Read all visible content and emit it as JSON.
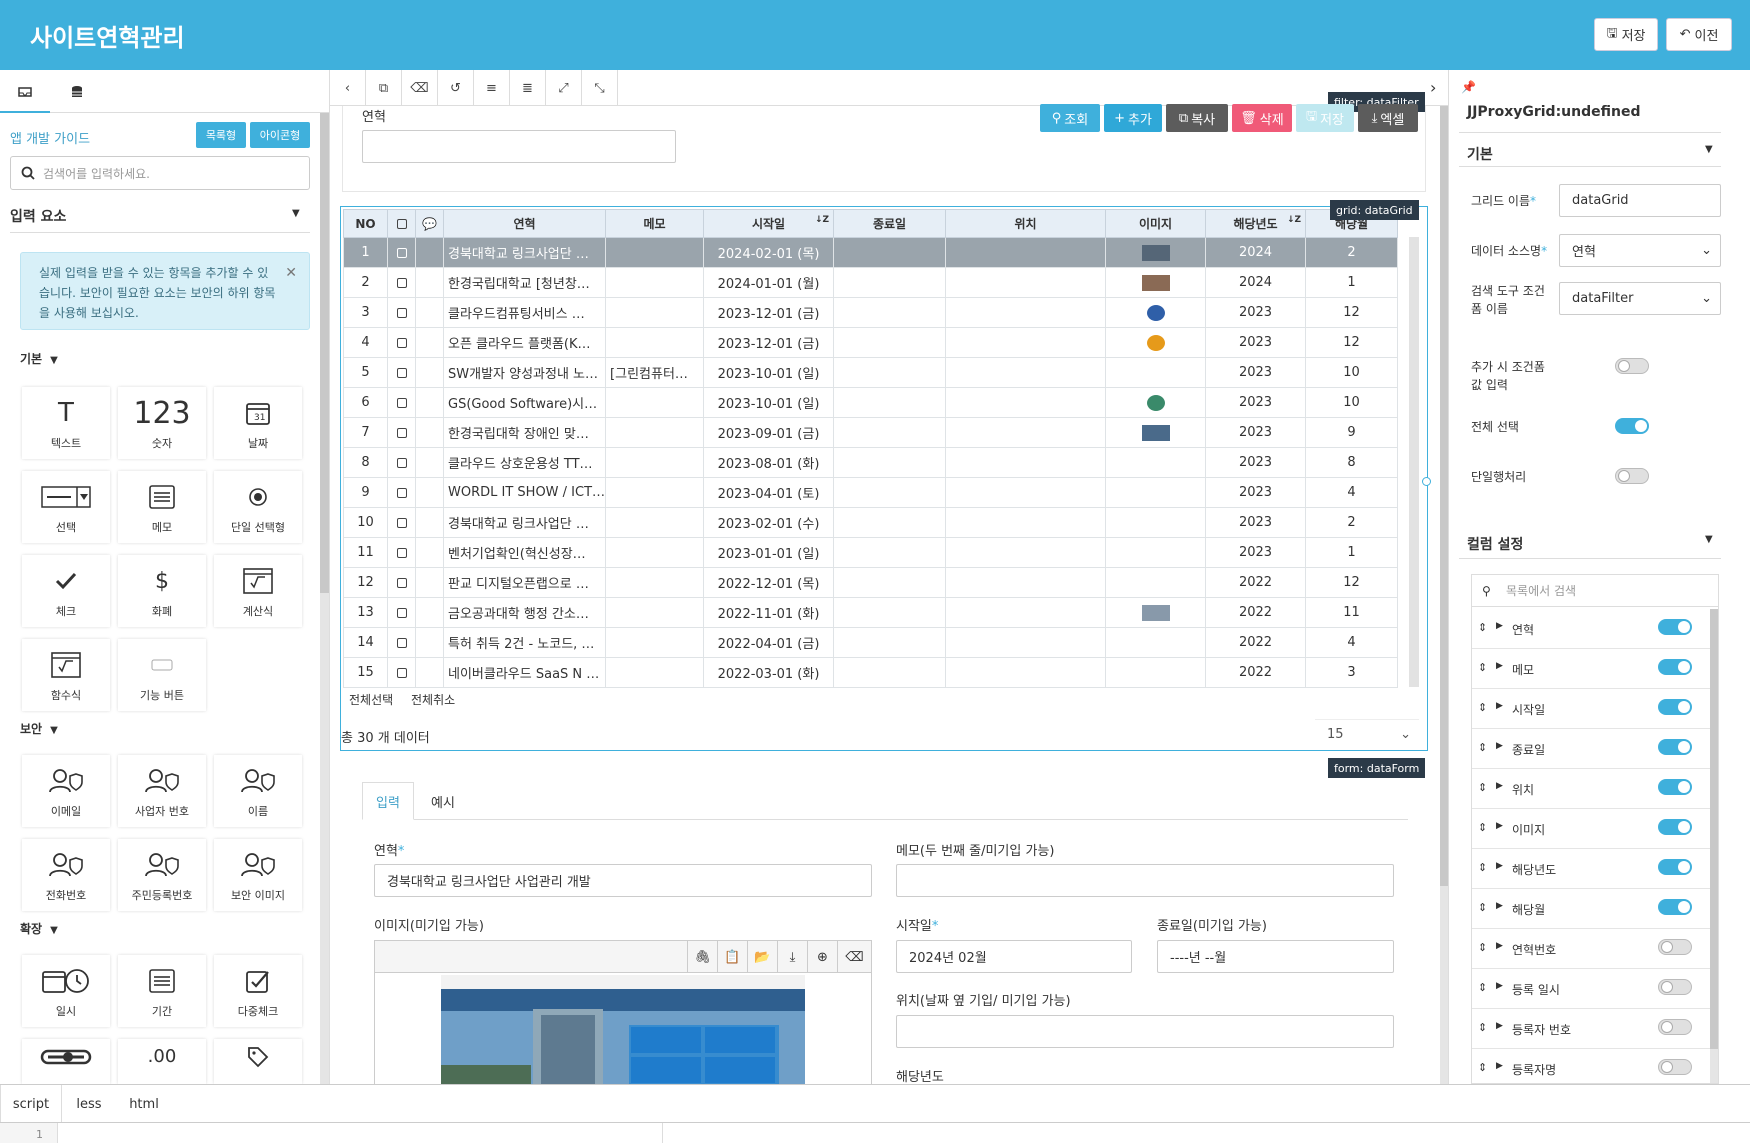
{
  "app": {
    "title": "사이트연혁관리",
    "save_label": "저장",
    "back_label": "이전"
  },
  "left": {
    "guide": "앱 개발 가이드",
    "list_btn": "목록형",
    "icon_btn": "아이콘형",
    "search_placeholder": "검색어를 입력하세요.",
    "section": "입력 요소",
    "alert": "실제 입력을 받을 수 있는 항목을 추가할 수 있습니다. 보안이 필요한 요소는 보안의 하위 항목을 사용해 보십시오.",
    "groups": {
      "basic": "기본",
      "security": "보안",
      "extend": "확장"
    },
    "tiles_basic": [
      "텍스트",
      "숫자",
      "날짜",
      "선택",
      "메모",
      "단일 선택형",
      "체크",
      "화폐",
      "계산식",
      "함수식",
      "기능 버튼"
    ],
    "tiles_security": [
      "이메일",
      "사업자 번호",
      "이름",
      "전화번호",
      "주민등록번호",
      "보안 이미지"
    ],
    "tiles_extend": [
      "일시",
      "기간",
      "다중체크"
    ],
    "number_glyph": "123",
    "text_glyph": "T",
    "currency_glyph": "$",
    "decimal_glyph": ".00"
  },
  "form_top": {
    "label": "연혁",
    "tag": "filter: dataFilter"
  },
  "actions": {
    "search": "조회",
    "add": "추가",
    "copy": "복사",
    "delete": "삭제",
    "save": "저장",
    "excel": "엑셀"
  },
  "grid": {
    "tag": "grid: dataGrid",
    "headers": [
      "NO",
      "",
      "",
      "연혁",
      "메모",
      "시작일",
      "종료일",
      "위치",
      "이미지",
      "해당년도",
      "해당월"
    ],
    "rows": [
      [
        "1",
        "경북대학교 링크사업단 …",
        "",
        "2024-02-01 (목)",
        "",
        "",
        "img",
        "2024",
        "2"
      ],
      [
        "2",
        "한경국립대학교 [청년창…",
        "",
        "2024-01-01 (월)",
        "",
        "",
        "img",
        "2024",
        "1"
      ],
      [
        "3",
        "클라우드컴퓨팅서비스 …",
        "",
        "2023-12-01 (금)",
        "",
        "",
        "img",
        "2023",
        "12"
      ],
      [
        "4",
        "오픈 클라우드 플랫폼(K…",
        "",
        "2023-12-01 (금)",
        "",
        "",
        "img",
        "2023",
        "12"
      ],
      [
        "5",
        "SW개발자 양성과정내 노…",
        "[그린컴퓨터…",
        "2023-10-01 (일)",
        "",
        "",
        "",
        "2023",
        "10"
      ],
      [
        "6",
        "GS(Good Software)시…",
        "",
        "2023-10-01 (일)",
        "",
        "",
        "img",
        "2023",
        "10"
      ],
      [
        "7",
        "한경국립대학 장애인 맞…",
        "",
        "2023-09-01 (금)",
        "",
        "",
        "img",
        "2023",
        "9"
      ],
      [
        "8",
        "클라우드 상호운용성 TT…",
        "",
        "2023-08-01 (화)",
        "",
        "",
        "",
        "2023",
        "8"
      ],
      [
        "9",
        "WORDL IT SHOW / ICT…",
        "",
        "2023-04-01 (토)",
        "",
        "",
        "",
        "2023",
        "4"
      ],
      [
        "10",
        "경북대학교 링크사업단 …",
        "",
        "2023-02-01 (수)",
        "",
        "",
        "",
        "2023",
        "2"
      ],
      [
        "11",
        "벤처기업확인(혁신성장…",
        "",
        "2023-01-01 (일)",
        "",
        "",
        "",
        "2023",
        "1"
      ],
      [
        "12",
        "판교 디지털오픈랩으로 …",
        "",
        "2022-12-01 (목)",
        "",
        "",
        "",
        "2022",
        "12"
      ],
      [
        "13",
        "금오공과대학 행정 간소…",
        "",
        "2022-11-01 (화)",
        "",
        "",
        "img",
        "2022",
        "11"
      ],
      [
        "14",
        "특허 취득 2건 - 노코드, …",
        "",
        "2022-04-01 (금)",
        "",
        "",
        "",
        "2022",
        "4"
      ],
      [
        "15",
        "네이버클라우드 SaaS N …",
        "",
        "2022-03-01 (화)",
        "",
        "",
        "",
        "2022",
        "3"
      ]
    ],
    "select_all": "전체선택",
    "deselect_all": "전체취소",
    "total": "총 30 개 데이터",
    "page_size": "15"
  },
  "form": {
    "tag": "form: dataForm",
    "tab_input": "입력",
    "tab_example": "예시",
    "history_label": "연혁",
    "history_value": "경북대학교 링크사업단 사업관리 개발",
    "memo_label": "메모(두 번째 줄/미기입 가능)",
    "image_label": "이미지(미기입 가능)",
    "start_label": "시작일",
    "start_value": "2024년 02월",
    "end_label": "종료일(미기입 가능)",
    "end_value": "----년 --월",
    "location_label": "위치(날짜 옆 기입/ 미기입 가능)",
    "year_label": "해당년도"
  },
  "right": {
    "component": "JJProxyGrid:undefined",
    "basic": "기본",
    "grid_name_label": "그리드 이름",
    "grid_name": "dataGrid",
    "source_label": "데이터 소스명",
    "source": "연혁",
    "filter_label": "검색 도구 조건 폼 이름",
    "filter": "dataFilter",
    "add_cond_label": "추가 시 조건폼 값 입력",
    "select_all_label": "전체 선택",
    "single_row_label": "단일행처리",
    "col_settings": "컬럼 설정",
    "col_search": "목록에서 검색",
    "columns": [
      {
        "name": "연혁",
        "on": true
      },
      {
        "name": "메모",
        "on": true
      },
      {
        "name": "시작일",
        "on": true
      },
      {
        "name": "종료일",
        "on": true
      },
      {
        "name": "위치",
        "on": true
      },
      {
        "name": "이미지",
        "on": true
      },
      {
        "name": "해당년도",
        "on": true
      },
      {
        "name": "해당월",
        "on": true
      },
      {
        "name": "연혁번호",
        "on": false
      },
      {
        "name": "등록 일시",
        "on": false
      },
      {
        "name": "등록자 번호",
        "on": false
      },
      {
        "name": "등록자명",
        "on": false
      }
    ]
  },
  "bottom": {
    "tabs": [
      "script",
      "less",
      "html"
    ],
    "line": "1"
  },
  "colors": {
    "accent": "#3fb0dc",
    "search": "#3fb0dc",
    "add": "#2fa8d8",
    "copy": "#5c5c5c",
    "delete": "#f05a78",
    "save": "#bfe8f0",
    "excel": "#5c5c5c"
  }
}
